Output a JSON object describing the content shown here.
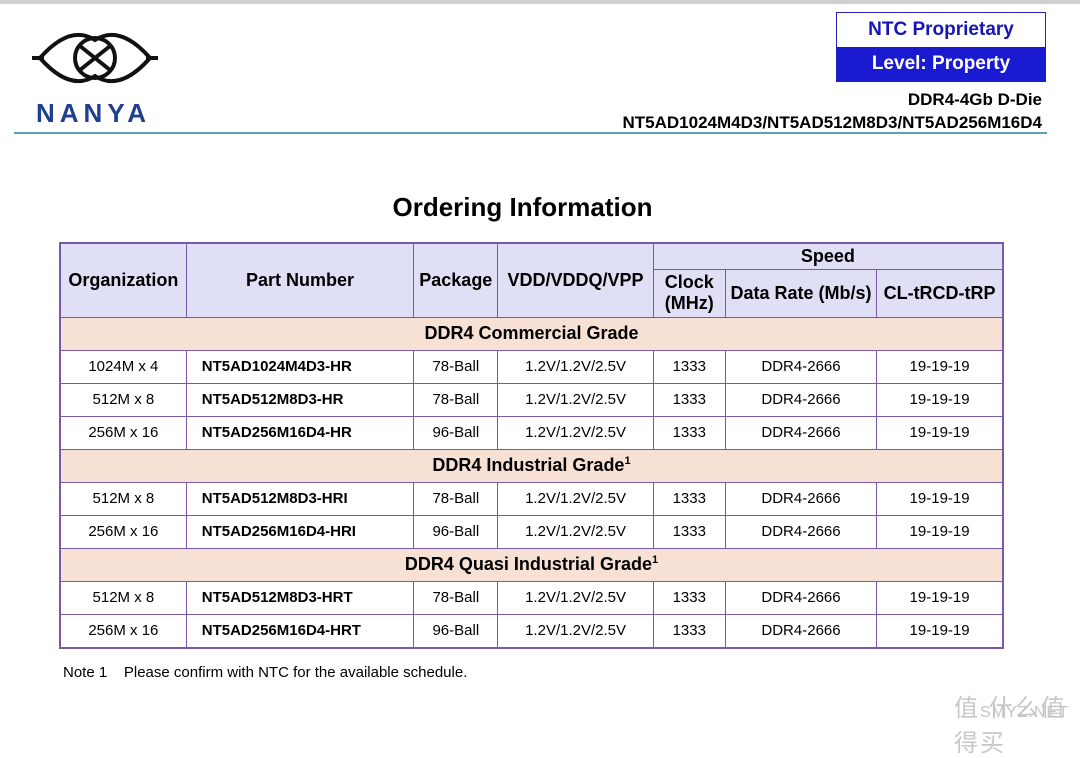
{
  "header": {
    "brand": "NANYA",
    "ntc_label": "NTC Proprietary",
    "level_label": "Level: Property",
    "product_line": "DDR4-4Gb D-Die",
    "part_numbers": "NT5AD1024M4D3/NT5AD512M8D3/NT5AD256M16D4"
  },
  "title": "Ordering Information",
  "table": {
    "headers": {
      "organization": "Organization",
      "part_number": "Part Number",
      "package": "Package",
      "voltage": "VDD/VDDQ/VPP",
      "speed": "Speed",
      "clock": "Clock (MHz)",
      "data_rate": "Data Rate (Mb/s)",
      "cl": "CL-tRCD-tRP"
    },
    "groups": [
      {
        "name": "DDR4 Commercial Grade",
        "sup": "",
        "rows": [
          {
            "org": "1024M x 4",
            "pn": "NT5AD1024M4D3-HR",
            "pkg": "78-Ball",
            "vdd": "1.2V/1.2V/2.5V",
            "clock": "1333",
            "rate": "DDR4-2666",
            "cl": "19-19-19"
          },
          {
            "org": "512M x 8",
            "pn": "NT5AD512M8D3-HR",
            "pkg": "78-Ball",
            "vdd": "1.2V/1.2V/2.5V",
            "clock": "1333",
            "rate": "DDR4-2666",
            "cl": "19-19-19"
          },
          {
            "org": "256M x 16",
            "pn": "NT5AD256M16D4-HR",
            "pkg": "96-Ball",
            "vdd": "1.2V/1.2V/2.5V",
            "clock": "1333",
            "rate": "DDR4-2666",
            "cl": "19-19-19"
          }
        ]
      },
      {
        "name": "DDR4 Industrial Grade",
        "sup": "1",
        "rows": [
          {
            "org": "512M x 8",
            "pn": "NT5AD512M8D3-HRI",
            "pkg": "78-Ball",
            "vdd": "1.2V/1.2V/2.5V",
            "clock": "1333",
            "rate": "DDR4-2666",
            "cl": "19-19-19"
          },
          {
            "org": "256M x 16",
            "pn": "NT5AD256M16D4-HRI",
            "pkg": "96-Ball",
            "vdd": "1.2V/1.2V/2.5V",
            "clock": "1333",
            "rate": "DDR4-2666",
            "cl": "19-19-19"
          }
        ]
      },
      {
        "name": "DDR4 Quasi Industrial Grade",
        "sup": "1",
        "rows": [
          {
            "org": "512M x 8",
            "pn": "NT5AD512M8D3-HRT",
            "pkg": "78-Ball",
            "vdd": "1.2V/1.2V/2.5V",
            "clock": "1333",
            "rate": "DDR4-2666",
            "cl": "19-19-19"
          },
          {
            "org": "256M x 16",
            "pn": "NT5AD256M16D4-HRT",
            "pkg": "96-Ball",
            "vdd": "1.2V/1.2V/2.5V",
            "clock": "1333",
            "rate": "DDR4-2666",
            "cl": "19-19-19"
          }
        ]
      }
    ]
  },
  "note": "Note 1    Please confirm with NTC for the available schedule.",
  "watermark": {
    "cn": "值 什么值得买",
    "en": "SMYZ.NET"
  },
  "colors": {
    "border": "#7a5aa8",
    "header_bg": "#dfe0f6",
    "grade_bg": "#f6e1d4",
    "ntc_blue": "#1a1ad0",
    "brand_blue": "#1f3f8f",
    "rule": "#5aa0b8"
  }
}
